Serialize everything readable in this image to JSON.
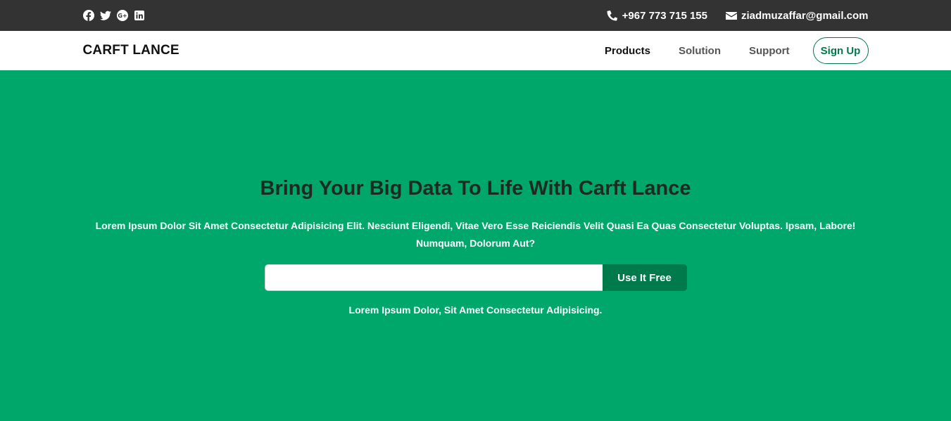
{
  "topbar": {
    "social_icons": [
      "facebook-icon",
      "twitter-icon",
      "google-plus-icon",
      "linkedin-icon"
    ],
    "phone": "+967 773 715 155",
    "email": "ziadmuzaffar@gmail.com"
  },
  "navbar": {
    "brand": "CARFT LANCE",
    "links": [
      "Products",
      "Solution",
      "Support"
    ],
    "signup": "Sign Up"
  },
  "hero": {
    "title": "Bring Your Big Data To Life With Carft Lance",
    "lead": "Lorem Ipsum Dolor Sit Amet Consectetur Adipisicing Elit. Nesciunt Eligendi, Vitae Vero Esse Reiciendis Velit Quasi Ea Quas Consectetur Voluptas. Ipsam, Labore! Numquam, Dolorum Aut?",
    "input_value": "",
    "button": "Use It Free",
    "sub": "Lorem Ipsum Dolor, Sit Amet Consectetur Adipisicing."
  },
  "colors": {
    "topbar": "#333333",
    "hero": "#00a76a",
    "accent_dark": "#00794b"
  }
}
